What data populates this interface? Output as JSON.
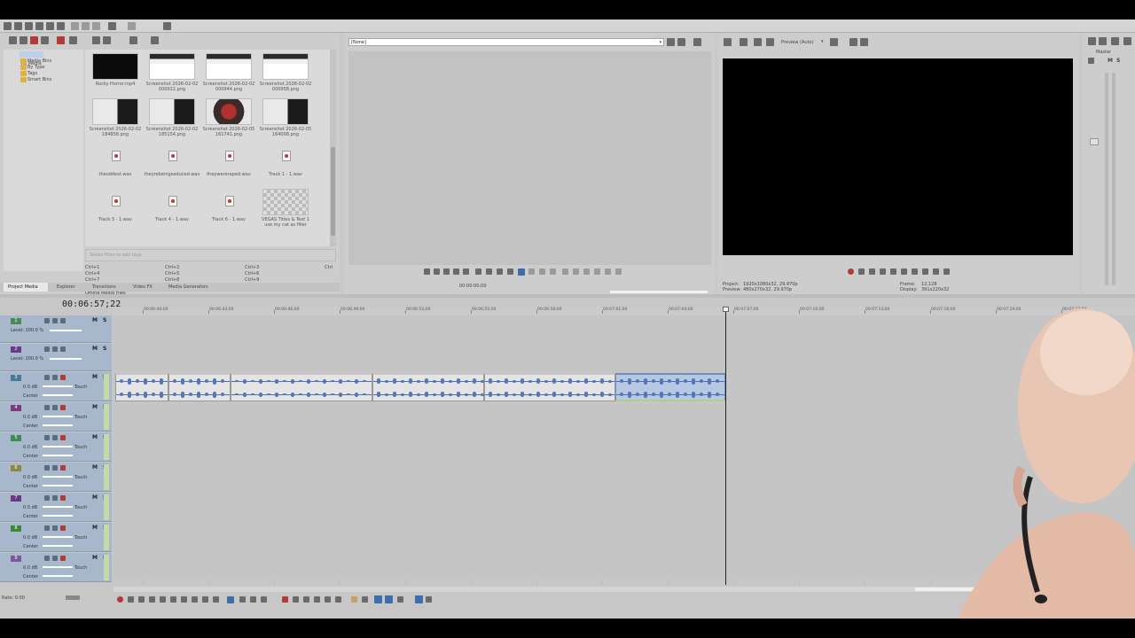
{
  "colors": {
    "accent_blue": "#3d6ea8",
    "track_header": "#a7b8cc",
    "selected_clip": "#b6c8e2",
    "record_red": "#b33a3a"
  },
  "explorer": {
    "tree": [
      "All Media",
      "Media Bins",
      "By Type",
      "Tags",
      "Smart Bins"
    ],
    "media": [
      {
        "caption": "Rocky Horror.mp4",
        "kind": "black"
      },
      {
        "caption": "Screenshot 2026-02-02 000922.png",
        "kind": "scr"
      },
      {
        "caption": "Screenshot 2026-02-02 000944.png",
        "kind": "scr"
      },
      {
        "caption": "Screenshot 2026-02-02 000958.png",
        "kind": "scr"
      },
      {
        "caption": "Screenshot 2026-02-02 184858.png",
        "kind": "scr2"
      },
      {
        "caption": "Screenshot 2026-02-02 185154.png",
        "kind": "scr2"
      },
      {
        "caption": "Screenshot 2026-02-05 161741.png",
        "kind": "photo"
      },
      {
        "caption": "Screenshot 2026-02-05 164008.png",
        "kind": "scr2"
      },
      {
        "caption": "theoddest.wav",
        "kind": "wav"
      },
      {
        "caption": "theyrebeingseduced.wav",
        "kind": "wav"
      },
      {
        "caption": "theywereraped.wav",
        "kind": "wav"
      },
      {
        "caption": "Track 1 - 1.wav",
        "kind": "wav"
      },
      {
        "caption": "Track 3 - 1.wav",
        "kind": "wav"
      },
      {
        "caption": "Track 4 - 1.wav",
        "kind": "wav"
      },
      {
        "caption": "Track 6 - 1.wav",
        "kind": "wav"
      },
      {
        "caption": "VEGAS Titles & Text 1 use my cat as filler",
        "kind": "checker"
      }
    ],
    "search_placeholder": "Select filter to add tags",
    "shortcuts": [
      "Ctrl+1",
      "Ctrl+4",
      "Ctrl+7",
      "Ctrl+2",
      "Ctrl+5",
      "Ctrl+8",
      "Ctrl+3",
      "Ctrl+6",
      "Ctrl+9",
      "Ctrl"
    ],
    "status": "Offline Media Files"
  },
  "tabs": [
    "Project Media",
    "Explorer",
    "Transitions",
    "Video FX",
    "Media Generators"
  ],
  "trimmer": {
    "dropdown_value": "[None]",
    "time1": "00:00:00;00"
  },
  "preview": {
    "mode": "Preview (Auto)",
    "project_label": "Project:",
    "project_value": "1920x1080x32, 29.970p",
    "preview_label": "Preview:",
    "preview_value": "480x270x32, 29.970p",
    "frame_label": "Frame:",
    "frame_value": "12,128",
    "display_label": "Display:",
    "display_value": "391x220x32"
  },
  "master": {
    "label": "Master"
  },
  "timeline": {
    "timecode": "00:06:57;22",
    "ruler": [
      "00:06:40;00",
      "00:06:43;00",
      "00:06:46;00",
      "00:06:49;00",
      "00:06:52;00",
      "00:06:55;00",
      "00:06:58;00",
      "00:07:01;00",
      "00:07:04;00",
      "00:07:07;00",
      "00:07:10;00",
      "00:07:13;00",
      "00:07:16;00",
      "00:07:19;00",
      "00:07:22;00"
    ],
    "tracks": [
      {
        "num": "1",
        "type": "video",
        "level": "Level: 100.0 %"
      },
      {
        "num": "2",
        "type": "video",
        "level": "Level: 100.0 %"
      },
      {
        "num": "3",
        "type": "audio",
        "vol": "0.0 dB",
        "pan": "Center",
        "touch": "Touch"
      },
      {
        "num": "4",
        "type": "audio",
        "vol": "0.0 dB",
        "pan": "Center",
        "touch": "Touch"
      },
      {
        "num": "5",
        "type": "audio",
        "vol": "0.0 dB",
        "pan": "Center",
        "touch": "Touch"
      },
      {
        "num": "6",
        "type": "audio",
        "vol": "0.0 dB",
        "pan": "Center",
        "touch": "Touch"
      },
      {
        "num": "7",
        "type": "audio",
        "vol": "0.0 dB",
        "pan": "Center",
        "touch": "Touch"
      },
      {
        "num": "8",
        "type": "audio",
        "vol": "0.0 dB",
        "pan": "Center",
        "touch": "Touch"
      },
      {
        "num": "9",
        "type": "audio",
        "vol": "0.0 dB",
        "pan": "Center",
        "touch": "Touch"
      }
    ],
    "rate": "Rate: 0.00"
  }
}
